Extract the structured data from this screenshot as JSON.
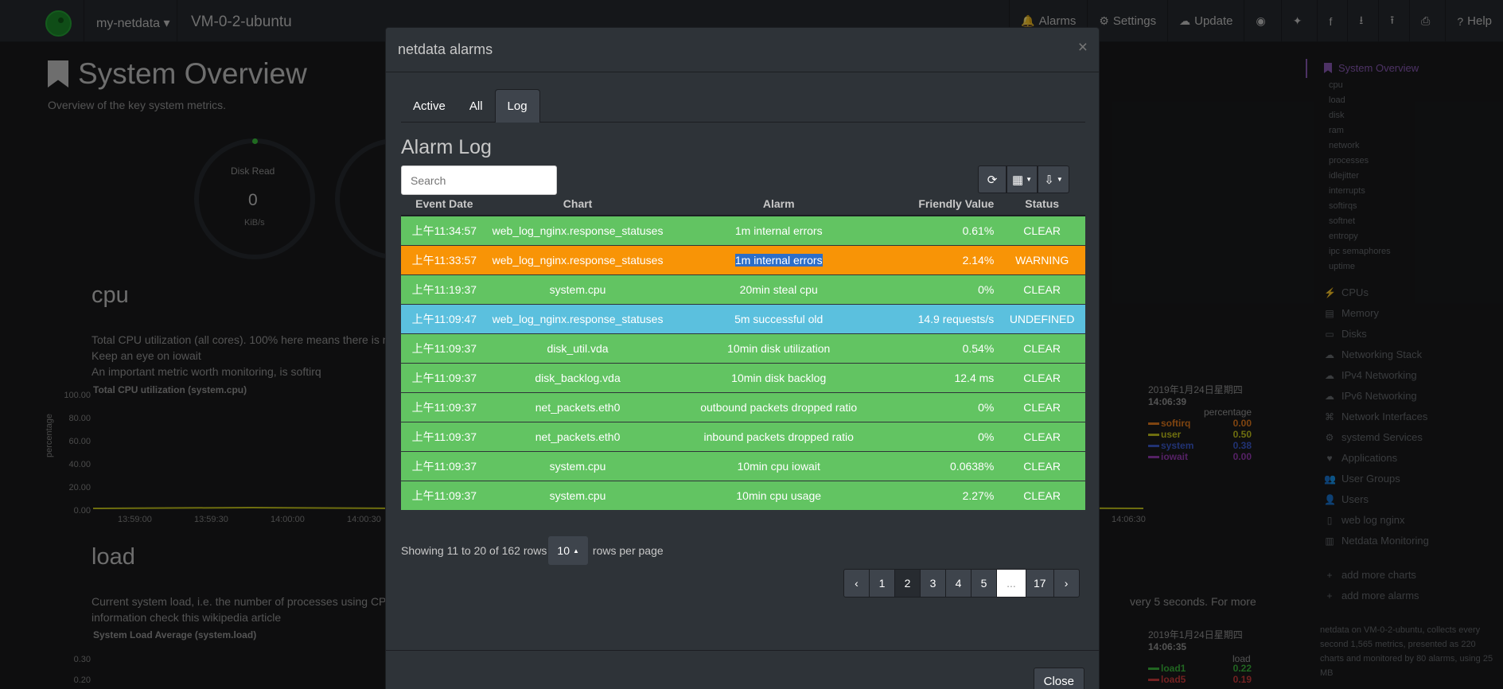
{
  "navbar": {
    "host_menu": "my-netdata ▾",
    "host_title": "VM-0-2-ubuntu",
    "items": [
      {
        "icon": "bell-icon",
        "glyph": "🔔",
        "label": "Alarms"
      },
      {
        "icon": "gear-icon",
        "glyph": "⚙",
        "label": "Settings"
      },
      {
        "icon": "cloud-download-icon",
        "glyph": "☁",
        "label": "Update"
      },
      {
        "icon": "github-icon",
        "glyph": "◉",
        "label": ""
      },
      {
        "icon": "twitter-icon",
        "glyph": "✦",
        "label": ""
      },
      {
        "icon": "facebook-icon",
        "glyph": "f",
        "label": ""
      },
      {
        "icon": "download-icon",
        "glyph": "⭳",
        "label": ""
      },
      {
        "icon": "upload-icon",
        "glyph": "⭱",
        "label": ""
      },
      {
        "icon": "print-icon",
        "glyph": "⎙",
        "label": ""
      },
      {
        "icon": "question-icon",
        "glyph": "?",
        "label": "Help"
      }
    ]
  },
  "page": {
    "title": "System Overview",
    "subtitle": "Overview of the key system metrics.",
    "gauge_label": "Disk Read",
    "gauge_value": "0",
    "gauge_unit": "KiB/s",
    "cpu_heading": "cpu",
    "cpu_para_1": "Total CPU utilization (all cores). 100% here means there is n",
    "cpu_para_2": "Keep an eye on iowait",
    "cpu_para_3": "An important metric worth monitoring, is softirq",
    "cpu_chart_title": "Total CPU utilization (system.cpu)",
    "cpu_yticks": [
      "100.00",
      "80.00",
      "60.00",
      "40.00",
      "20.00",
      "0.00"
    ],
    "cpu_xticks": [
      "13:59:00",
      "13:59:30",
      "14:00:00",
      "14:00:30"
    ],
    "cpu_xtick_right": "14:06:30",
    "cpu_ylabel": "percentage",
    "cpu_legend_date": "2019年1月24日星期四",
    "cpu_legend_time": "14:06:39",
    "cpu_legend_unit": "percentage",
    "cpu_legend": [
      {
        "name": "softirq",
        "value": "0.00",
        "color": "#e87d1e"
      },
      {
        "name": "user",
        "value": "0.50",
        "color": "#c8c81c"
      },
      {
        "name": "system",
        "value": "0.38",
        "color": "#3c5bd1"
      },
      {
        "name": "iowait",
        "value": "0.00",
        "color": "#9c3cb8"
      }
    ],
    "load_heading": "load",
    "load_para_1": "Current system load, i.e. the number of processes using CP",
    "load_para_1b": "very 5 seconds. For more",
    "load_para_2": "information check this wikipedia article",
    "load_chart_title": "System Load Average (system.load)",
    "load_yticks": [
      "0.30",
      "0.20"
    ],
    "load_ylabel": "load",
    "load_legend_date": "2019年1月24日星期四",
    "load_legend_time": "14:06:35",
    "load_legend_unit": "load",
    "load_legend": [
      {
        "name": "load1",
        "value": "0.22",
        "color": "#3cb83c"
      },
      {
        "name": "load5",
        "value": "0.19",
        "color": "#d13c3c"
      }
    ]
  },
  "sidebar": {
    "active": "System Overview",
    "subitems": [
      "cpu",
      "load",
      "disk",
      "ram",
      "network",
      "processes",
      "idlejitter",
      "interrupts",
      "softirqs",
      "softnet",
      "entropy",
      "ipc semaphores",
      "uptime"
    ],
    "items": [
      {
        "icon": "bolt-icon",
        "glyph": "⚡",
        "label": "CPUs"
      },
      {
        "icon": "memory-icon",
        "glyph": "▤",
        "label": "Memory"
      },
      {
        "icon": "hdd-icon",
        "glyph": "▭",
        "label": "Disks"
      },
      {
        "icon": "cloud-icon",
        "glyph": "☁",
        "label": "Networking Stack"
      },
      {
        "icon": "cloud-icon",
        "glyph": "☁",
        "label": "IPv4 Networking"
      },
      {
        "icon": "cloud-icon",
        "glyph": "☁",
        "label": "IPv6 Networking"
      },
      {
        "icon": "sitemap-icon",
        "glyph": "⌘",
        "label": "Network Interfaces"
      },
      {
        "icon": "cogs-icon",
        "glyph": "⚙",
        "label": "systemd Services"
      },
      {
        "icon": "heart-icon",
        "glyph": "♥",
        "label": "Applications"
      },
      {
        "icon": "users-icon",
        "glyph": "👥",
        "label": "User Groups"
      },
      {
        "icon": "user-icon",
        "glyph": "👤",
        "label": "Users"
      },
      {
        "icon": "file-icon",
        "glyph": "▯",
        "label": "web log nginx"
      },
      {
        "icon": "chart-icon",
        "glyph": "▥",
        "label": "Netdata Monitoring"
      },
      {
        "icon": "plus-icon",
        "glyph": "+",
        "label": "add more charts"
      },
      {
        "icon": "plus-icon",
        "glyph": "+",
        "label": "add more alarms"
      }
    ],
    "footer": "netdata on VM-0-2-ubuntu, collects every second 1,565 metrics, presented as 220 charts and monitored by 80 alarms, using 25 MB"
  },
  "modal": {
    "title": "netdata alarms",
    "close_x": "×",
    "tabs": [
      "Active",
      "All",
      "Log"
    ],
    "active_tab": "Log",
    "log_title": "Alarm Log",
    "search_placeholder": "Search",
    "toolbar": [
      {
        "icon": "refresh-icon",
        "glyph": "⟳"
      },
      {
        "icon": "columns-icon",
        "glyph": "▦"
      },
      {
        "icon": "export-icon",
        "glyph": "⇩"
      }
    ],
    "columns": [
      "Event Date",
      "Chart",
      "Alarm",
      "Friendly Value",
      "Status"
    ],
    "rows": [
      {
        "date": "上午11:34:57",
        "chart": "web_log_nginx.response_statuses",
        "alarm": "1m internal errors",
        "value": "0.61%",
        "status": "CLEAR",
        "kind": "clear"
      },
      {
        "date": "上午11:33:57",
        "chart": "web_log_nginx.response_statuses",
        "alarm": "1m internal errors",
        "value": "2.14%",
        "status": "WARNING",
        "kind": "warning"
      },
      {
        "date": "上午11:19:37",
        "chart": "system.cpu",
        "alarm": "20min steal cpu",
        "value": "0%",
        "status": "CLEAR",
        "kind": "clear"
      },
      {
        "date": "上午11:09:47",
        "chart": "web_log_nginx.response_statuses",
        "alarm": "5m successful old",
        "value": "14.9 requests/s",
        "status": "UNDEFINED",
        "kind": "undefined"
      },
      {
        "date": "上午11:09:37",
        "chart": "disk_util.vda",
        "alarm": "10min disk utilization",
        "value": "0.54%",
        "status": "CLEAR",
        "kind": "clear"
      },
      {
        "date": "上午11:09:37",
        "chart": "disk_backlog.vda",
        "alarm": "10min disk backlog",
        "value": "12.4 ms",
        "status": "CLEAR",
        "kind": "clear"
      },
      {
        "date": "上午11:09:37",
        "chart": "net_packets.eth0",
        "alarm": "outbound packets dropped ratio",
        "value": "0%",
        "status": "CLEAR",
        "kind": "clear"
      },
      {
        "date": "上午11:09:37",
        "chart": "net_packets.eth0",
        "alarm": "inbound packets dropped ratio",
        "value": "0%",
        "status": "CLEAR",
        "kind": "clear"
      },
      {
        "date": "上午11:09:37",
        "chart": "system.cpu",
        "alarm": "10min cpu iowait",
        "value": "0.0638%",
        "status": "CLEAR",
        "kind": "clear"
      },
      {
        "date": "上午11:09:37",
        "chart": "system.cpu",
        "alarm": "10min cpu usage",
        "value": "2.27%",
        "status": "CLEAR",
        "kind": "clear"
      }
    ],
    "showing_text": "Showing 11 to 20 of 162 rows",
    "rows_per_page": "10",
    "rows_per_page_suffix": "rows per page",
    "pagination": [
      {
        "label": "‹",
        "kind": "prev"
      },
      {
        "label": "1",
        "kind": "page"
      },
      {
        "label": "2",
        "kind": "active"
      },
      {
        "label": "3",
        "kind": "page"
      },
      {
        "label": "4",
        "kind": "page"
      },
      {
        "label": "5",
        "kind": "page"
      },
      {
        "label": "...",
        "kind": "ellipsis"
      },
      {
        "label": "17",
        "kind": "page"
      },
      {
        "label": "›",
        "kind": "next"
      }
    ],
    "close_button": "Close"
  },
  "colors": {
    "clear": "#62c462",
    "warning": "#f89406",
    "undefined": "#5bc0de",
    "accent": "#8d5cb8"
  }
}
